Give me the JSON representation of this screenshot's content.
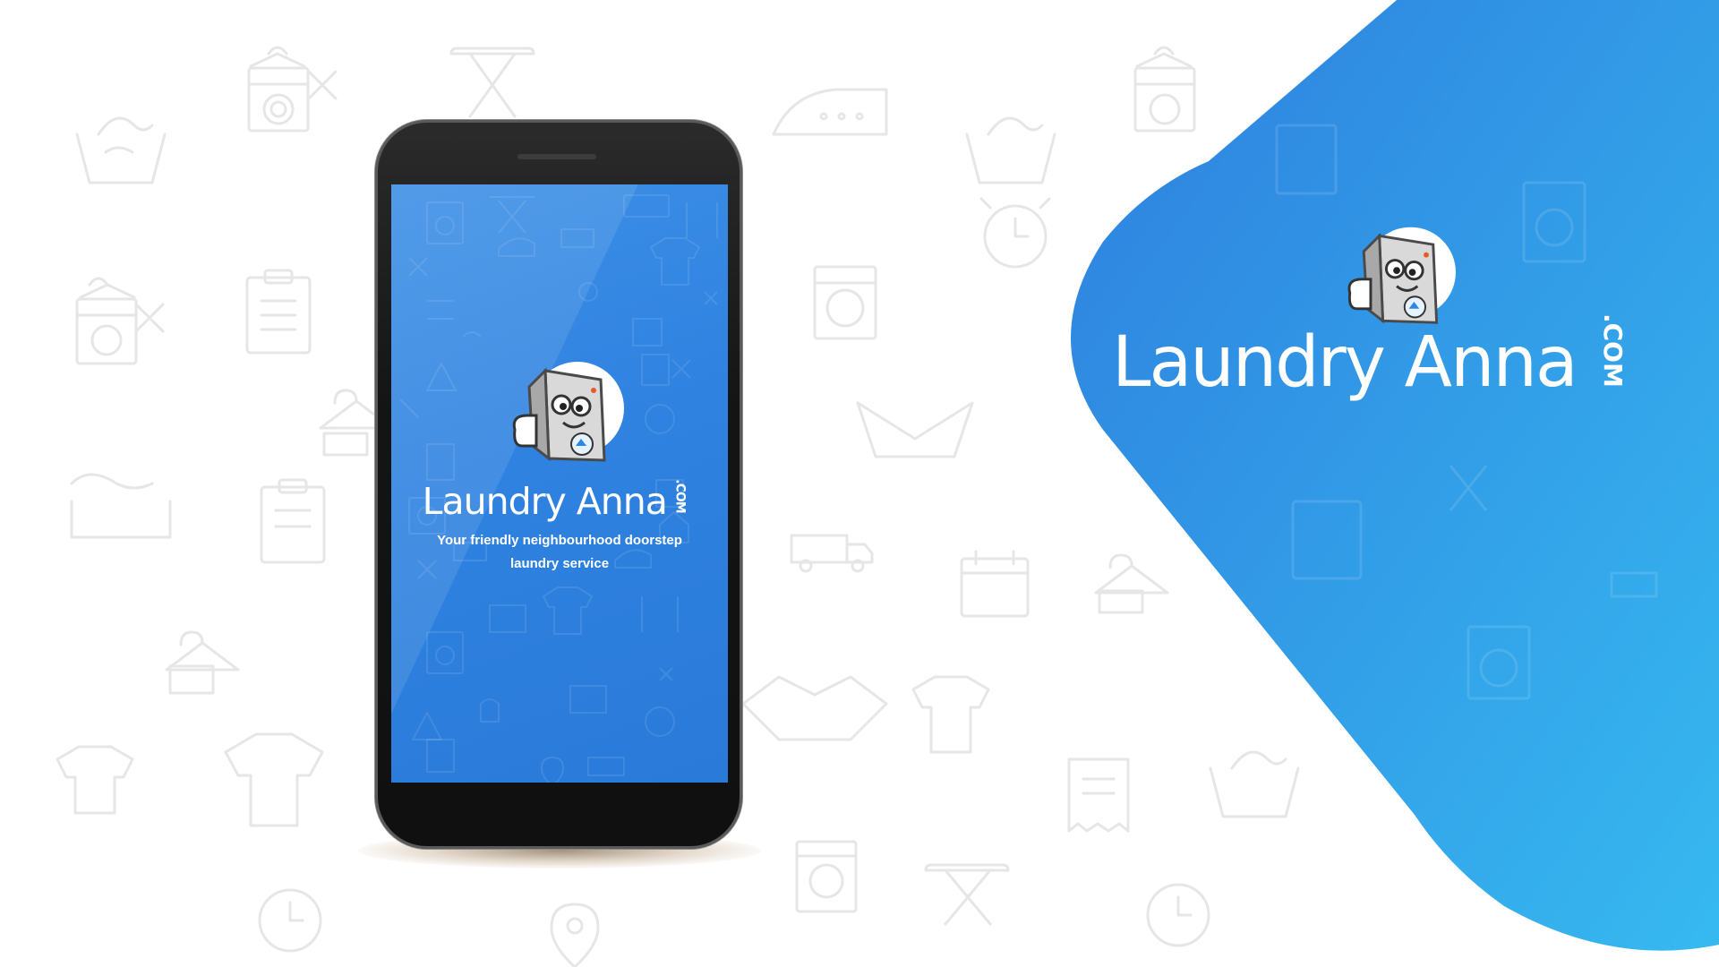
{
  "brand": {
    "name": "Laundry Anna",
    "tld": ".COM"
  },
  "splash": {
    "title": "Laundry Anna",
    "tld": ".COM",
    "tagline_line1": "Your friendly neighbourhood doorstep",
    "tagline_line2": "laundry service"
  },
  "colors": {
    "brand_blue": "#2f86e0",
    "brand_blue_light": "#35b3ee",
    "doodle_gray": "#e9e9e9"
  },
  "icons": {
    "background_icons": [
      "washing-machine-icon",
      "ironing-board-icon",
      "iron-icon",
      "hand-wash-icon",
      "clothes-hanger-icon",
      "clipboard-icon",
      "alarm-clock-icon",
      "calendar-icon",
      "delivery-van-icon",
      "shirt-icon",
      "location-pin-icon",
      "receipt-icon",
      "handshake-icon",
      "mobile-phone-icon"
    ],
    "mascot": "washing-machine-mascot-icon"
  }
}
